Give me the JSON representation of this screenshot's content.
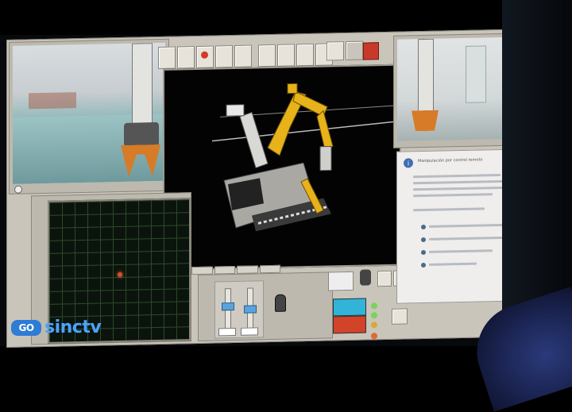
{
  "logo": {
    "icon_text": "GO",
    "text": "sinctv"
  },
  "right_panel": {
    "header": "Manipulación por control remoto",
    "bullet_items": [
      "",
      "",
      "",
      ""
    ]
  },
  "tabs": [
    "",
    "",
    "",
    ""
  ],
  "colors": {
    "accent_blue": "#2d7cd6",
    "crane_yellow": "#e8b21a",
    "cyan_button": "#32b4d8",
    "red_button": "#d2432a"
  }
}
